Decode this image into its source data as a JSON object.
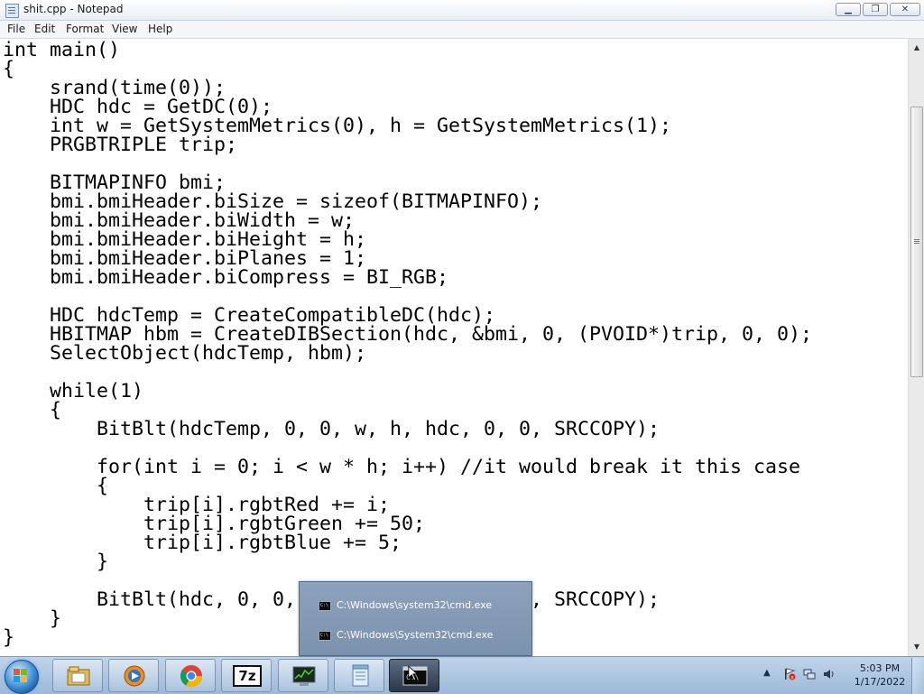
{
  "window": {
    "title": "shit.cpp - Notepad",
    "min_glyph": "▁",
    "max_glyph": "❐",
    "close_glyph": "✕"
  },
  "menu": [
    "File",
    "Edit",
    "Format",
    "View",
    "Help"
  ],
  "code_lines": [
    "int main()",
    "{",
    "    srand(time(0));",
    "    HDC hdc = GetDC(0);",
    "    int w = GetSystemMetrics(0), h = GetSystemMetrics(1);",
    "    PRGBTRIPLE trip;",
    "",
    "    BITMAPINFO bmi;",
    "    bmi.bmiHeader.biSize = sizeof(BITMAPINFO);",
    "    bmi.bmiHeader.biWidth = w;",
    "    bmi.bmiHeader.biHeight = h;",
    "    bmi.bmiHeader.biPlanes = 1;",
    "    bmi.bmiHeader.biCompress = BI_RGB;",
    "",
    "    HDC hdcTemp = CreateCompatibleDC(hdc);",
    "    HBITMAP hbm = CreateDIBSection(hdc, &bmi, 0, (PVOID*)trip, 0, 0);",
    "    SelectObject(hdcTemp, hbm);",
    "",
    "    while(1)",
    "    {",
    "        BitBlt(hdcTemp, 0, 0, w, h, hdc, 0, 0, SRCCOPY);",
    "",
    "        for(int i = 0; i < w * h; i++) //it would break it this case",
    "        {",
    "            trip[i].rgbtRed += i;",
    "            trip[i].rgbtGreen += 50;",
    "            trip[i].rgbtBlue += 5;",
    "        }",
    "",
    "        BitBlt(hdc, 0, 0, w, h, hdcTemp, 0, 0, SRCCOPY);",
    "    }",
    "}"
  ],
  "scrollbar": {
    "up_glyph": "▲",
    "down_glyph": "▼"
  },
  "popup": {
    "items": [
      "C:\\Windows\\system32\\cmd.exe",
      "C:\\Windows\\System32\\cmd.exe"
    ]
  },
  "taskbar": {
    "items": [
      "start",
      "explorer",
      "media-player",
      "chrome",
      "7-zip",
      "task-manager",
      "notepad",
      "cmd"
    ],
    "zip_label": "7z"
  },
  "tray": {
    "arrow_glyph": "▲",
    "time": "5:03 PM",
    "date": "1/17/2022"
  },
  "colors": {
    "taskbar": "#a9c3df",
    "popup": "#8298b3",
    "active_task": "#3a475a"
  }
}
